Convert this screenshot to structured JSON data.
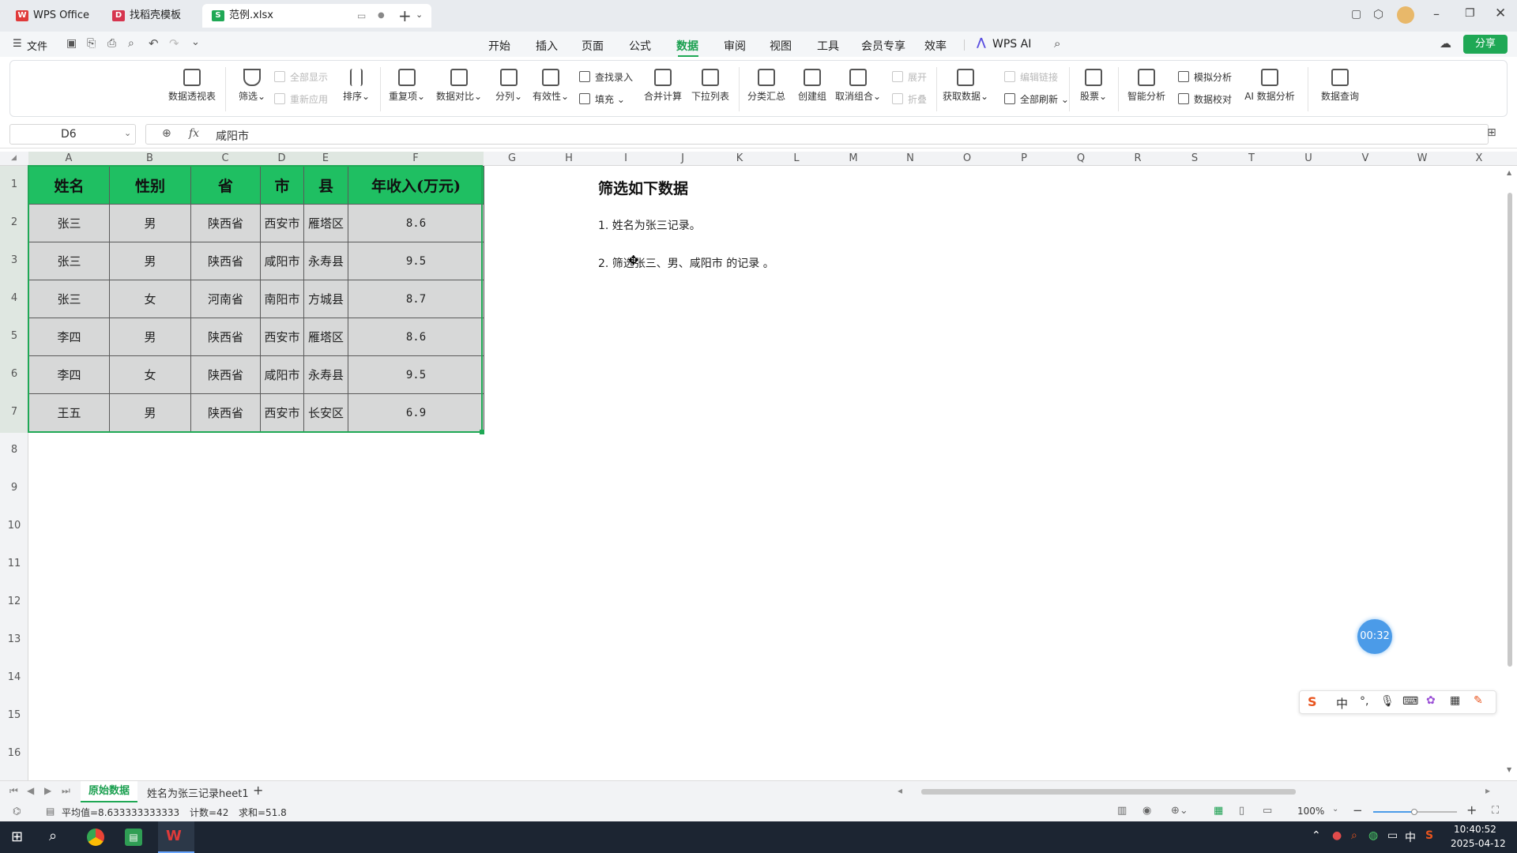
{
  "tabs": [
    {
      "label": "WPS Office",
      "icon": "wps-logo-icon"
    },
    {
      "label": "找稻壳模板",
      "icon": "daoke-icon"
    },
    {
      "label": "范例.xlsx",
      "icon": "sheet-file-icon"
    }
  ],
  "menu": {
    "file": "文件",
    "items": [
      "开始",
      "插入",
      "页面",
      "公式",
      "数据",
      "审阅",
      "视图",
      "工具",
      "会员专享",
      "效率",
      "WPS AI"
    ],
    "active": "数据",
    "share": "分享"
  },
  "ribbon": {
    "pivot": "数据透视表",
    "filter": "筛选",
    "show_all": "全部显示",
    "reapply": "重新应用",
    "sort": "排序",
    "duplicates": "重复项",
    "compare": "数据对比",
    "split": "分列",
    "validity": "有效性",
    "lookup_entry": "查找录入",
    "fill": "填充",
    "consolidate": "合并计算",
    "dropdown": "下拉列表",
    "subtotal": "分类汇总",
    "group": "创建组",
    "ungroup": "取消组合",
    "expand": "展开",
    "collapse": "折叠",
    "get_data": "获取数据",
    "edit_links": "编辑链接",
    "refresh_all": "全部刷新",
    "stock": "股票",
    "smart_analysis": "智能分析",
    "what_if": "模拟分析",
    "data_check": "数据校对",
    "ai_analysis": "AI 数据分析",
    "data_query": "数据查询"
  },
  "formula_bar": {
    "cell_ref": "D6",
    "fx": "fx",
    "value": "咸阳市"
  },
  "columns": [
    "A",
    "B",
    "C",
    "D",
    "E",
    "F",
    "G",
    "H",
    "I",
    "J",
    "K",
    "L",
    "M",
    "N",
    "O",
    "P",
    "Q",
    "R",
    "S",
    "T",
    "U",
    "V",
    "W",
    "X"
  ],
  "rows": [
    "1",
    "2",
    "3",
    "4",
    "5",
    "6",
    "7",
    "8",
    "9",
    "10",
    "11",
    "12",
    "13",
    "14",
    "15",
    "16"
  ],
  "table": {
    "headers": [
      "姓名",
      "性别",
      "省",
      "市",
      "县",
      "年收入(万元)"
    ],
    "rows": [
      [
        "张三",
        "男",
        "陕西省",
        "西安市",
        "雁塔区",
        "8.6"
      ],
      [
        "张三",
        "男",
        "陕西省",
        "咸阳市",
        "永寿县",
        "9.5"
      ],
      [
        "张三",
        "女",
        "河南省",
        "南阳市",
        "方城县",
        "8.7"
      ],
      [
        "李四",
        "男",
        "陕西省",
        "西安市",
        "雁塔区",
        "8.6"
      ],
      [
        "李四",
        "女",
        "陕西省",
        "咸阳市",
        "永寿县",
        "9.5"
      ],
      [
        "王五",
        "男",
        "陕西省",
        "西安市",
        "长安区",
        "6.9"
      ]
    ]
  },
  "notes": {
    "title": "筛选如下数据",
    "item1": "1.  姓名为张三记录。",
    "item2": "2.  筛选张三、男、咸阳市 的记录 。"
  },
  "timer": "00:32",
  "ime": [
    "中"
  ],
  "sheets": [
    "原始数据",
    "姓名为张三记录heet1"
  ],
  "active_sheet": "原始数据",
  "status": {
    "average": "平均值=8.633333333333",
    "count": "计数=42",
    "sum": "求和=51.8",
    "zoom": "100%"
  },
  "clock": {
    "time": "10:40:52",
    "date": "2025-04-12"
  },
  "colors": {
    "accent": "#1fa855",
    "header_fill": "#1fbf62",
    "cell_fill": "#d7d8d8",
    "taskbar": "#1c2532"
  }
}
